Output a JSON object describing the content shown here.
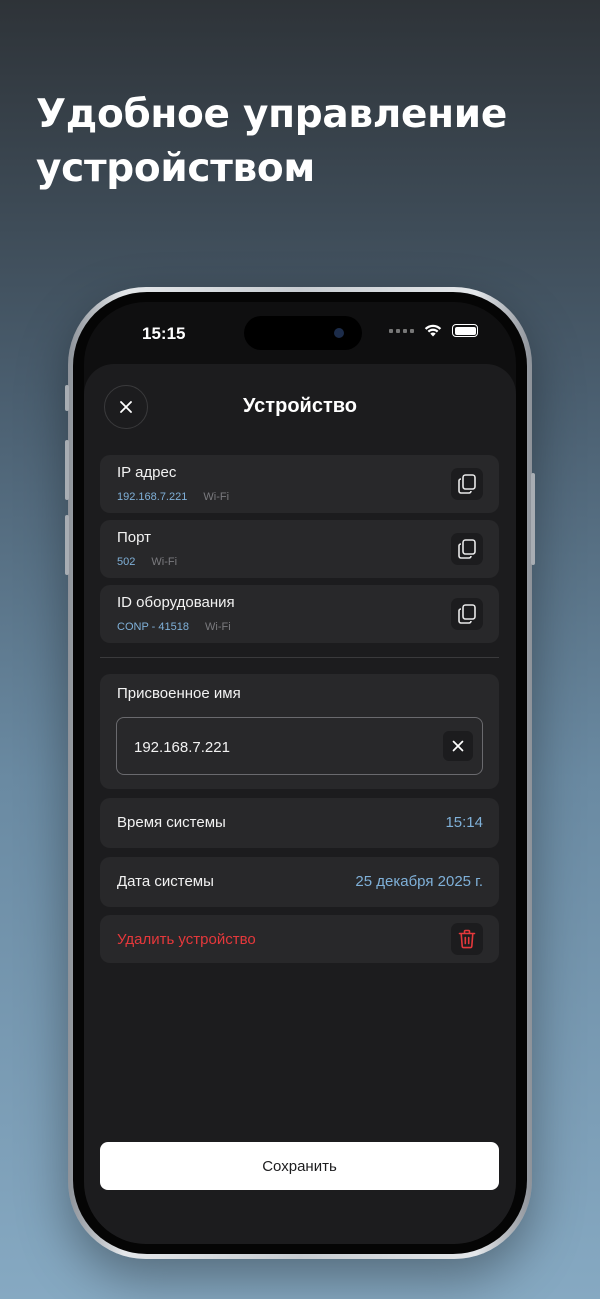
{
  "headline": {
    "line1": "Удобное управление",
    "line2": "устройством"
  },
  "status_bar": {
    "time": "15:15"
  },
  "sheet": {
    "title": "Устройство",
    "info_cards": [
      {
        "title": "IP адрес",
        "value": "192.168.7.221",
        "network": "Wi-Fi"
      },
      {
        "title": "Порт",
        "value": "502",
        "network": "Wi-Fi"
      },
      {
        "title": "ID оборудования",
        "value": "CONP - 41518",
        "network": "Wi-Fi"
      }
    ],
    "assigned_name": {
      "label": "Присвоенное имя",
      "value": "192.168.7.221"
    },
    "system_time": {
      "label": "Время системы",
      "value": "15:14"
    },
    "system_date": {
      "label": "Дата системы",
      "value": "25 декабря 2025 г."
    },
    "delete_label": "Удалить устройство",
    "save_label": "Сохранить"
  },
  "colors": {
    "accent": "#7fb0d8",
    "danger": "#e5383b",
    "sheet_bg": "#1c1c1e",
    "card_bg": "#28282a"
  },
  "icons": {
    "close": "close-icon",
    "copy": "copy-icon",
    "clear": "clear-icon",
    "trash": "trash-icon",
    "wifi": "wifi-icon",
    "battery": "battery-icon"
  }
}
